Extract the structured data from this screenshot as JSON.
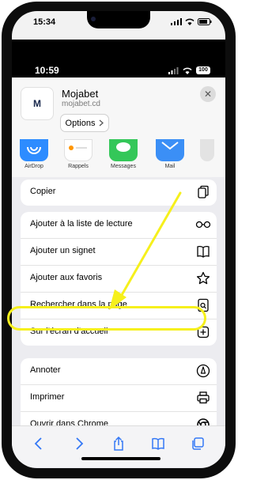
{
  "outer_status": {
    "time": "15:34"
  },
  "inner_status": {
    "time": "10:59",
    "battery": "100"
  },
  "share_sheet": {
    "site_title": "Mojabet",
    "site_url": "mojabet.cd",
    "site_logo": "M",
    "options_label": "Options",
    "apps": [
      {
        "label": "AirDrop",
        "icon": "airdrop-icon",
        "color": "#2d8cff"
      },
      {
        "label": "Rappels",
        "icon": "reminders-icon",
        "color": "#ffffff"
      },
      {
        "label": "Messages",
        "icon": "messages-icon",
        "color": "#34c759"
      },
      {
        "label": "Mail",
        "icon": "mail-icon",
        "color": "#3b8ff6"
      }
    ],
    "groups": [
      [
        {
          "label": "Copier",
          "icon": "copy-icon"
        }
      ],
      [
        {
          "label": "Ajouter à la liste de lecture",
          "icon": "reading-list-icon"
        },
        {
          "label": "Ajouter un signet",
          "icon": "bookmark-icon"
        },
        {
          "label": "Ajouter aux favoris",
          "icon": "star-icon"
        },
        {
          "label": "Rechercher dans la page",
          "icon": "find-on-page-icon"
        },
        {
          "label": "Sur l’écran d’accueil",
          "icon": "add-to-home-icon"
        }
      ],
      [
        {
          "label": "Annoter",
          "icon": "markup-icon"
        },
        {
          "label": "Imprimer",
          "icon": "print-icon"
        },
        {
          "label": "Ouvrir dans Chrome",
          "icon": "chrome-icon"
        }
      ]
    ]
  },
  "toolbar": [
    {
      "name": "back",
      "icon": "chevron-left-icon"
    },
    {
      "name": "forward",
      "icon": "chevron-right-icon"
    },
    {
      "name": "share",
      "icon": "share-icon"
    },
    {
      "name": "bookmarks",
      "icon": "book-icon"
    },
    {
      "name": "tabs",
      "icon": "tabs-icon"
    }
  ],
  "annotation": {
    "color": "#f6f01c"
  }
}
